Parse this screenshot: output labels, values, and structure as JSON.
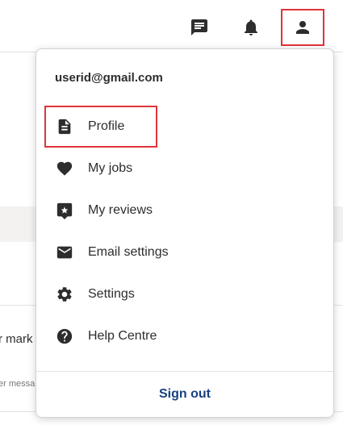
{
  "header": {
    "icons": {
      "messages": "chat-icon",
      "notifications": "bell-icon",
      "profile": "person-icon"
    }
  },
  "background": {
    "text_main": "r mark",
    "text_sub": "er messa"
  },
  "menu": {
    "email": "userid@gmail.com",
    "items": [
      {
        "label": "Profile",
        "icon": "document-icon"
      },
      {
        "label": "My jobs",
        "icon": "heart-icon"
      },
      {
        "label": "My reviews",
        "icon": "review-star-icon"
      },
      {
        "label": "Email settings",
        "icon": "envelope-icon"
      },
      {
        "label": "Settings",
        "icon": "gear-icon"
      },
      {
        "label": "Help Centre",
        "icon": "help-icon"
      }
    ],
    "sign_out": "Sign out"
  },
  "colors": {
    "accent_blue": "#164081",
    "highlight_red": "#e0343a",
    "text": "#2d2d2d"
  }
}
